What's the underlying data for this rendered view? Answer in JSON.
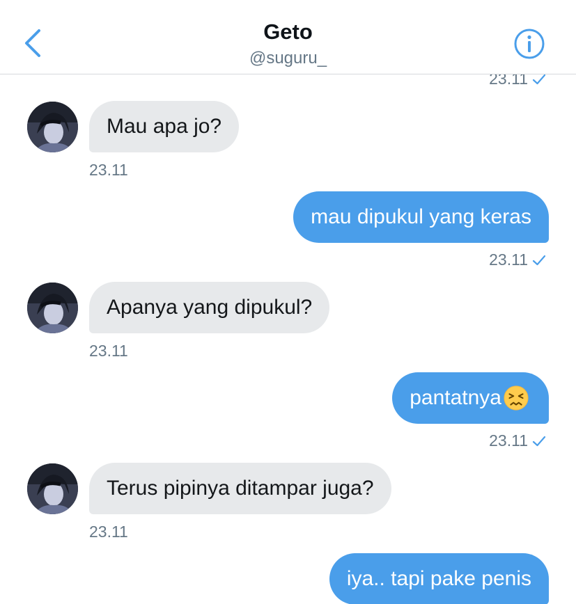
{
  "header": {
    "title": "Geto",
    "handle": "@suguru_"
  },
  "icons": {
    "back": "chevron-left-icon",
    "info": "info-circle-icon",
    "read": "check-icon",
    "emoji": "persevering-face-emoji"
  },
  "colors": {
    "accent": "#4a9eea",
    "incoming_bubble": "#e7e9eb",
    "muted_text": "#657786"
  },
  "top_partial_time": "23.11",
  "messages": [
    {
      "dir": "in",
      "text": "Mau apa jo?",
      "time": "23.11"
    },
    {
      "dir": "out",
      "text": "mau dipukul yang keras",
      "time": "23.11"
    },
    {
      "dir": "in",
      "text": "Apanya yang dipukul?",
      "time": "23.11"
    },
    {
      "dir": "out",
      "text": "pantatnya",
      "emoji": "😣",
      "time": "23.11"
    },
    {
      "dir": "in",
      "text": "Terus pipinya ditampar juga?",
      "time": "23.11"
    },
    {
      "dir": "out",
      "text": "iya.. tapi pake penis"
    }
  ]
}
